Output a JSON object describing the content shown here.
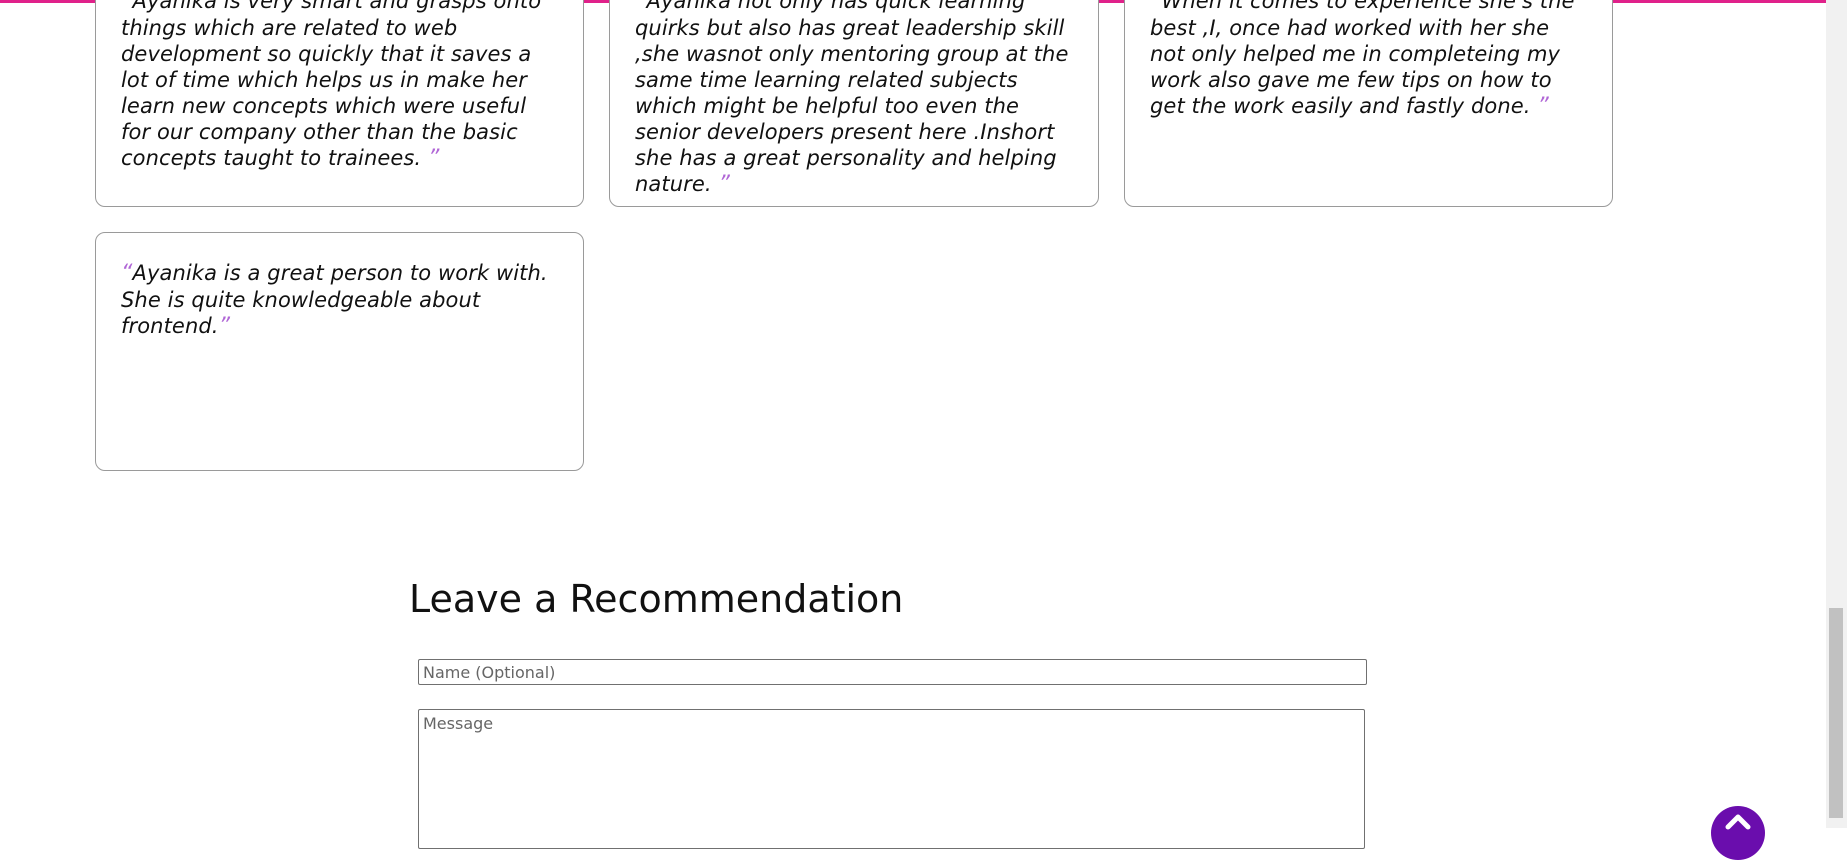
{
  "recommendations": [
    {
      "open_quote": "“",
      "text": "Ayanika is very smart and grasps onto things which are related to web development so quickly that it saves a lot of time which helps us in make her learn new concepts which were useful for our company other than the basic concepts taught to trainees. ",
      "close_quote": "”"
    },
    {
      "open_quote": "“",
      "text": "Ayanika not only has quick learning quirks but also has great leadership skill ,she wasnot only mentoring group at the same time learning related subjects which might be helpful too even the senior developers present here .Inshort she has a great personality and helping nature. ",
      "close_quote": "”"
    },
    {
      "open_quote": "“",
      "text": "When it comes to experience she's the best ,I, once had worked with her she not only helped me in completeing my work also gave me few tips on how to get the work easily and fastly done. ",
      "close_quote": "”"
    },
    {
      "open_quote": "“",
      "text": "Ayanika is a great person to work with. She is quite knowledgeable about frontend.",
      "close_quote": "”"
    }
  ],
  "form": {
    "title": "Leave a Recommendation",
    "name_placeholder": "Name (Optional)",
    "name_value": "",
    "message_placeholder": "Message",
    "message_value": ""
  },
  "scroll_top": {
    "icon": "chevron-up-icon",
    "color": "#6a0dad"
  },
  "colors": {
    "accent_bar": "#e0218a",
    "quote_mark": "#b066d6"
  }
}
